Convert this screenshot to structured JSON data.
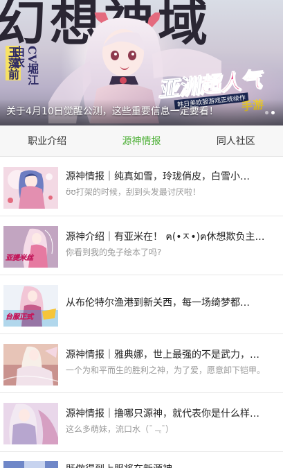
{
  "banner": {
    "big_title": "幻想神域",
    "side_tag_line1": "玉藻前",
    "side_tag_line2": "CV堀江由衣",
    "badge_main_left": "亚洲",
    "badge_main_right": "超人气",
    "badge_sub": "韩日美欧服游戏正统续作",
    "badge_game": "手游",
    "caption": "关于4月10日觉醒公测，这些重要信息一定要看！",
    "dots": 2,
    "active_dot": 1
  },
  "tabs": [
    {
      "label": "职业介绍",
      "active": false
    },
    {
      "label": "源神情报",
      "active": true
    },
    {
      "label": "同人社区",
      "active": false
    }
  ],
  "articles": [
    {
      "title": "源神情报｜纯真如雪，玲珑俏皮，白雪小…",
      "subtitle": "ʊ̈ʊ打架的时候，刮到头发最讨厌啦！",
      "thumb_text": ""
    },
    {
      "title": "源神介绍｜有亚米在！ ฅ(•ㅈ•)ฅ休想欺负主…",
      "subtitle": "你看到我的兔子绘本了吗?",
      "thumb_text": "亚提米丝"
    },
    {
      "title": "从布伦特尔渔港到新关西，每一场绮梦都…",
      "subtitle": "",
      "thumb_text": "台服正式"
    },
    {
      "title": "源神情报｜雅典娜，世上最强的不是武力，…",
      "subtitle": "一个为和平而生的胜利之神，为了爱，愿意卸下铠甲。",
      "thumb_text": ""
    },
    {
      "title": "源神情报｜撸哪只源神，就代表你是什么样…",
      "subtitle": "这么多萌妹，流口水（¯﹃¯）",
      "thumb_text": ""
    }
  ],
  "partial_article": {
    "title": "既做得到上服将在新源神…"
  },
  "colors": {
    "accent": "#4caf35",
    "tabs_bg": "#f7f7f7",
    "subtitle": "#999999"
  }
}
